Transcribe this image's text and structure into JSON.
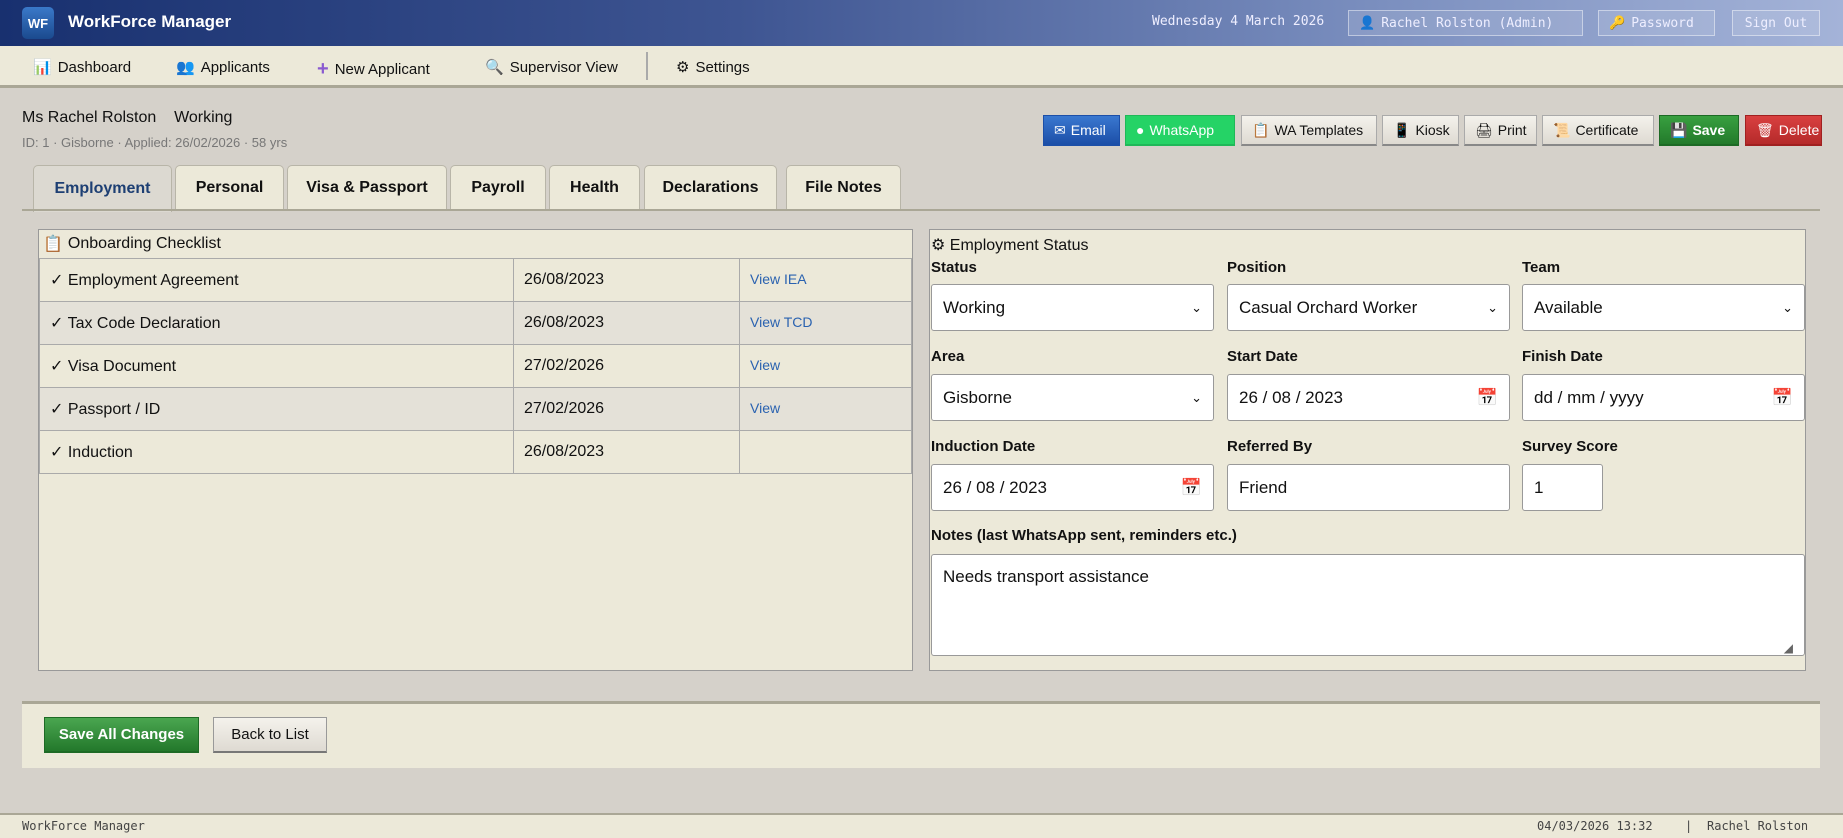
{
  "app": {
    "logo": "WF",
    "title": "WorkForce Manager"
  },
  "header": {
    "date": "Wednesday 4 March 2026",
    "user": "Rachel Rolston (Admin)",
    "password": "Password",
    "signout": "Sign Out"
  },
  "nav": {
    "items": [
      {
        "label": "Dashboard",
        "icon": "chart-icon"
      },
      {
        "label": "Applicants",
        "icon": "users-icon"
      },
      {
        "label": "New Applicant",
        "icon": "plus-icon"
      },
      {
        "label": "Supervisor View",
        "icon": "magnifier-icon"
      },
      {
        "label": "Settings",
        "icon": "gear-icon"
      }
    ]
  },
  "applicant": {
    "name": "Ms Rachel Rolston",
    "status": "Working",
    "meta": "ID: 1 · Gisborne · Applied: 26/02/2026 · 58 yrs"
  },
  "actions": {
    "email": "Email",
    "whatsapp": "WhatsApp",
    "wa_templates": "WA Templates",
    "kiosk": "Kiosk",
    "print": "Print",
    "certificate": "Certificate",
    "save": "Save",
    "delete": "Delete"
  },
  "tabs": [
    "Employment",
    "Personal",
    "Visa & Passport",
    "Payroll",
    "Health",
    "Declarations",
    "File Notes"
  ],
  "checklist": {
    "title": "Onboarding Checklist",
    "rows": [
      {
        "item": "✓ Employment Agreement",
        "date": "26/08/2023",
        "link": "View IEA"
      },
      {
        "item": "✓ Tax Code Declaration",
        "date": "26/08/2023",
        "link": "View TCD"
      },
      {
        "item": "✓ Visa Document",
        "date": "27/02/2026",
        "link": "View"
      },
      {
        "item": "✓ Passport / ID",
        "date": "27/02/2026",
        "link": "View"
      },
      {
        "item": "✓ Induction",
        "date": "26/08/2023",
        "link": ""
      }
    ]
  },
  "employment": {
    "title": "Employment Status",
    "status_label": "Status",
    "status": "Working",
    "position_label": "Position",
    "position": "Casual Orchard Worker",
    "team_label": "Team",
    "team": "Available",
    "area_label": "Area",
    "area": "Gisborne",
    "start_label": "Start Date",
    "start": "26 / 08 / 2023",
    "finish_label": "Finish Date",
    "finish_placeholder": "dd / mm / yyyy",
    "induction_label": "Induction Date",
    "induction": "26 / 08 / 2023",
    "referred_label": "Referred By",
    "referred": "Friend",
    "survey_label": "Survey Score",
    "survey": "1",
    "notes_label": "Notes (last WhatsApp sent, reminders etc.)",
    "notes": "Needs transport assistance"
  },
  "bottom": {
    "save_all": "Save All Changes",
    "back": "Back to List"
  },
  "footer": {
    "app": "WorkForce Manager",
    "datetime": "04/03/2026 13:32",
    "sep": "|",
    "user": "Rachel Rolston"
  },
  "colors": {
    "email": "#2259b8",
    "whatsapp": "#25d366",
    "save": "#2e8a35",
    "delete": "#c9302c",
    "active_tab": "#1d3f73"
  }
}
